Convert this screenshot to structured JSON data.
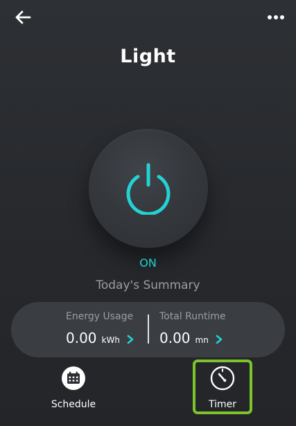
{
  "header": {
    "title": "Light",
    "back_icon": "arrow-left-icon",
    "more_icon": "more-horizontal-icon"
  },
  "power": {
    "icon": "power-icon",
    "state": "ON",
    "accent_color": "#22d3d3"
  },
  "summary": {
    "title": "Today's Summary",
    "energy": {
      "label": "Energy Usage",
      "value": "0.00",
      "unit": "kWh"
    },
    "runtime": {
      "label": "Total Runtime",
      "value": "0.00",
      "unit": "mn"
    }
  },
  "actions": {
    "schedule": {
      "label": "Schedule",
      "icon": "calendar-icon"
    },
    "timer": {
      "label": "Timer",
      "icon": "timer-icon",
      "highlight_color": "#7dc42c"
    }
  }
}
